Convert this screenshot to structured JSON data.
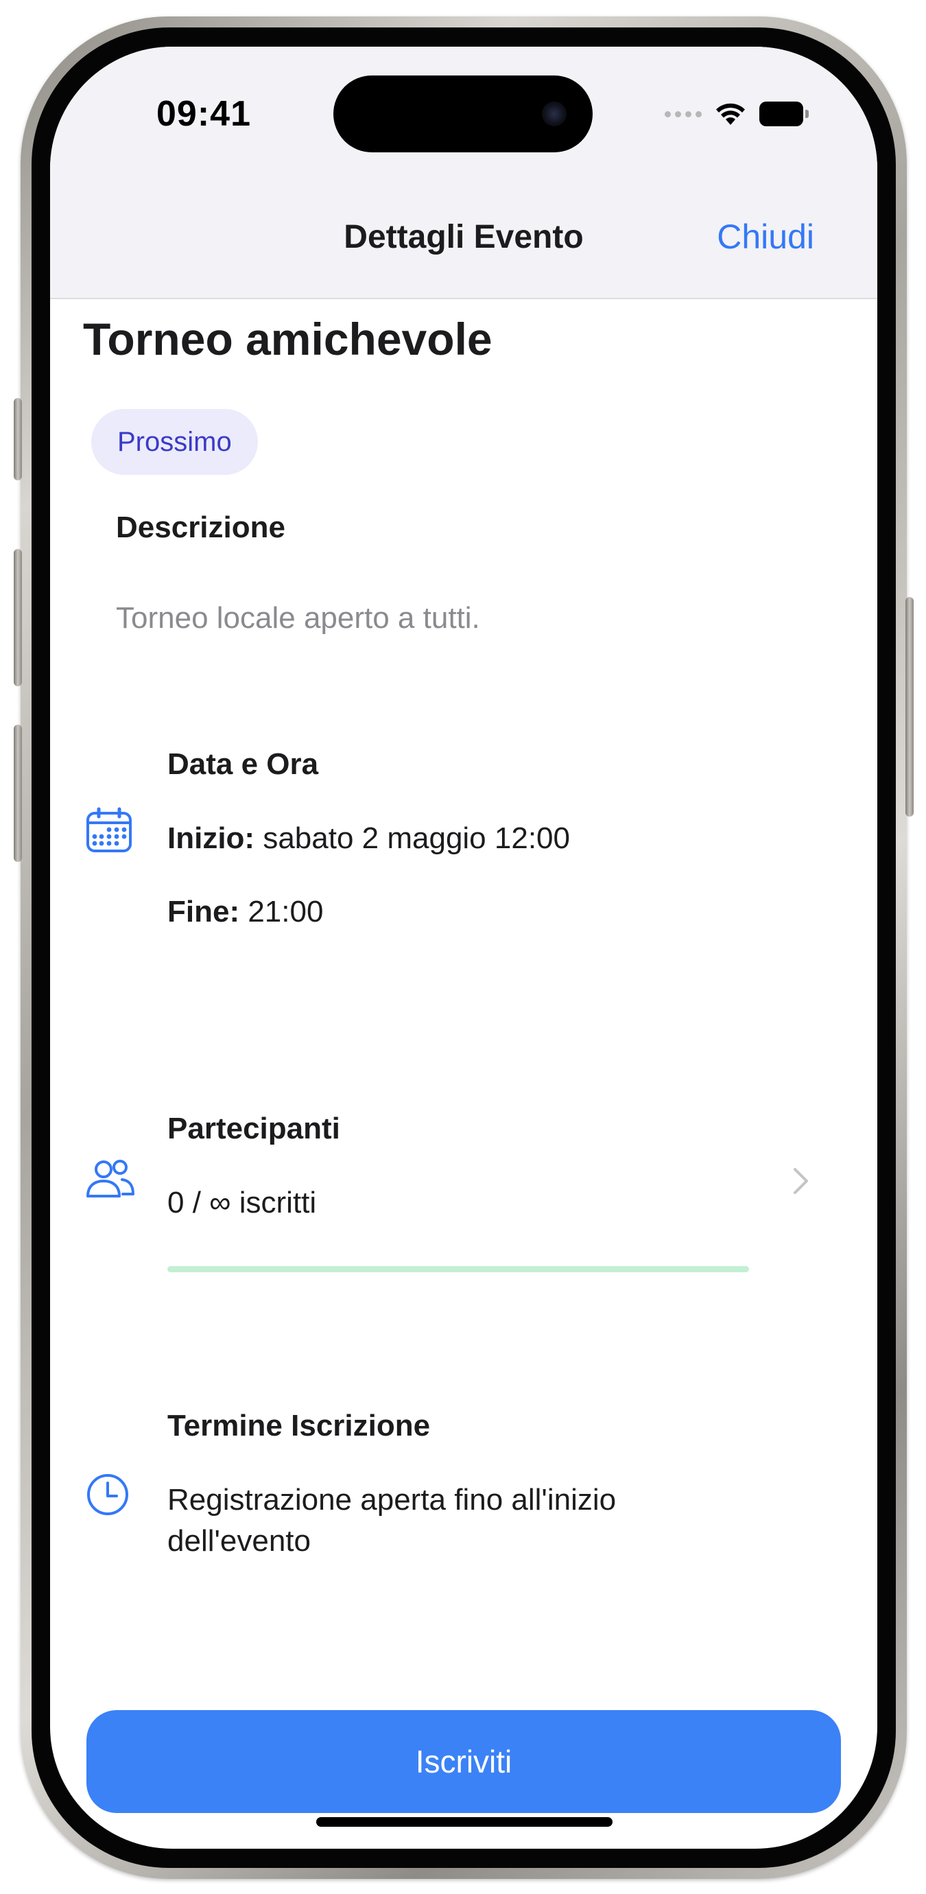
{
  "status_bar": {
    "time": "09:41"
  },
  "nav": {
    "title": "Dettagli Evento",
    "close_label": "Chiudi"
  },
  "event": {
    "title": "Torneo amichevole",
    "status_badge": "Prossimo",
    "description_label": "Descrizione",
    "description": "Torneo locale aperto a tutti."
  },
  "datetime": {
    "label": "Data e Ora",
    "start_label": "Inizio:",
    "start_value": " sabato 2 maggio 12:00",
    "end_label": "Fine:",
    "end_value": " 21:00",
    "icon": "calendar-icon"
  },
  "participants": {
    "label": "Partecipanti",
    "count_text": "0 / ∞ iscritti",
    "progress": 1.0,
    "progress_color": "#c3efd3",
    "icon": "people-icon"
  },
  "registration_deadline": {
    "label": "Termine Iscrizione",
    "text_line1": "Registrazione aperta fino all'inizio",
    "text_line2": "dell'evento",
    "icon": "clock-icon"
  },
  "cta": {
    "label": "Iscriviti",
    "color": "#3b82f6"
  },
  "colors": {
    "accent": "#3478f6",
    "badge_bg": "#ecebfb",
    "badge_text": "#3a3bc7"
  }
}
